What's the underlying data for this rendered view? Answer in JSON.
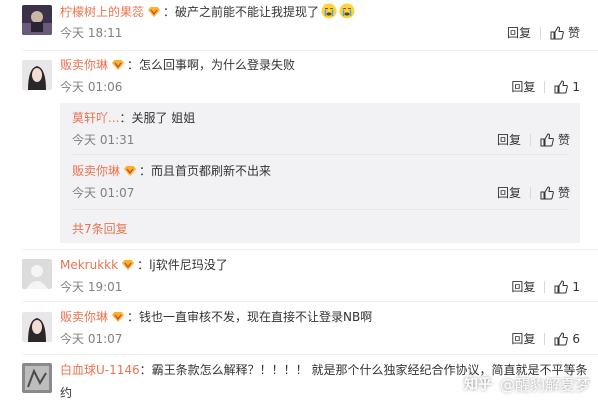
{
  "comments": [
    {
      "user": "柠檬树上的果蕊",
      "text": "破产之前能不能让我提现了",
      "time": "今天 18:11",
      "reply_label": "回复",
      "like_label": "赞",
      "emojis": [
        "crying-face-emoji",
        "crying-face-emoji"
      ]
    },
    {
      "user": "贩卖你琳",
      "text": "怎么回事啊，为什么登录失败",
      "time": "今天 01:06",
      "reply_label": "回复",
      "like_count": "1",
      "replies": [
        {
          "user": "莫轩吖...",
          "text": "关服了 姐姐",
          "time": "今天 01:31",
          "reply_label": "回复",
          "like_label": "赞"
        },
        {
          "user": "贩卖你琳",
          "text": "而且首页都刷新不出来",
          "time": "今天 01:07",
          "reply_label": "回复",
          "like_label": "赞"
        }
      ],
      "more_replies": "共7条回复"
    },
    {
      "user": "Mekrukkk",
      "text": "lj软件尼玛没了",
      "time": "今天 19:01",
      "reply_label": "回复",
      "like_count": "1"
    },
    {
      "user": "贩卖你琳",
      "text": "钱也一直审核不发，现在直接不让登录NB啊",
      "time": "今天 01:07",
      "reply_label": "回复",
      "like_count": "6"
    },
    {
      "user": "白血球U-1146",
      "text": "霸王条款怎么解释？！！！！ 就是那个什么独家经纪合作协议，简直就是不平等条",
      "text_cont": "约"
    }
  ],
  "watermark": {
    "logo": "知乎",
    "text": "@醒豹解夏梦"
  },
  "colors": {
    "username": "#eb7350",
    "time": "#808080",
    "reply_bg": "#f2f2f5",
    "vip": "#f7b32b"
  }
}
